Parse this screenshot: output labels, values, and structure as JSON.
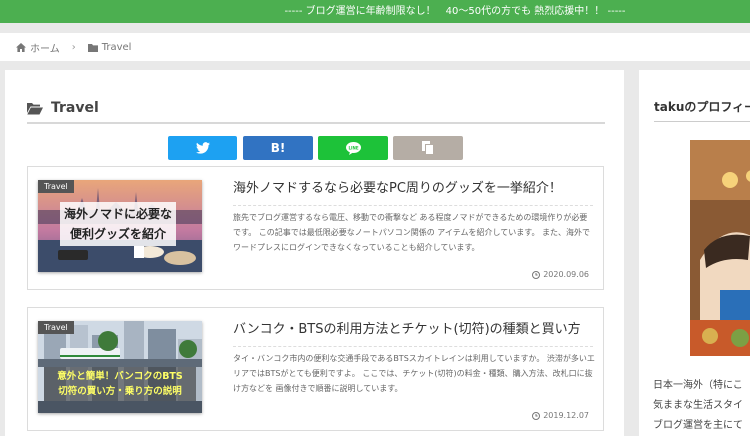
{
  "topbar": {
    "text": "----- ブログ運営に年齢制限なし！　40〜50代の方でも 熱烈応援中！！ -----"
  },
  "breadcrumb": {
    "home": "ホーム",
    "current": "Travel"
  },
  "archive": {
    "title": "Travel"
  },
  "share": {
    "hatena": "B!"
  },
  "posts": [
    {
      "category": "Travel",
      "thumb_text": [
        "海外ノマドに必要な",
        "便利グッズを紹介"
      ],
      "title": "海外ノマドするなら必要なPC周りのグッズを一挙紹介！",
      "description": "旅先でブログ運営するなら電圧、移動での衝撃など ある程度ノマドができるための環境作りが必要です。 この記事では最低限必要なノートパソコン関係の アイテムを紹介しています。 また、海外でワードプレスにログインできなくなっていることも紹介しています。",
      "date": "2020.09.06"
    },
    {
      "category": "Travel",
      "thumb_text": [
        "意外と簡単！バンコクのBTS",
        "切符の買い方・乗り方の説明"
      ],
      "title": "バンコク・BTSの利用方法とチケット(切符)の種類と買い方",
      "description": "タイ・バンコク市内の便利な交通手段であるBTSスカイトレインは利用していますか。 渋滞が多いエリアではBTSがとても便利ですよ。 ここでは、チケット(切符)の料金・種類、購入方法、改札口に抜け方などを 画像付きで順番に説明しています。",
      "date": "2019.12.07"
    }
  ],
  "sidebar": {
    "title": "takuのプロフィール",
    "text_lines": [
      "日本一海外（特にこ",
      "気ままな生活スタイ",
      "ブログ運営を主にて"
    ]
  },
  "colors": {
    "topbar": "#4caf50",
    "twitter": "#1da1f2",
    "hatena": "#3173c2",
    "line": "#1dc239",
    "copy": "#b5ada5"
  }
}
